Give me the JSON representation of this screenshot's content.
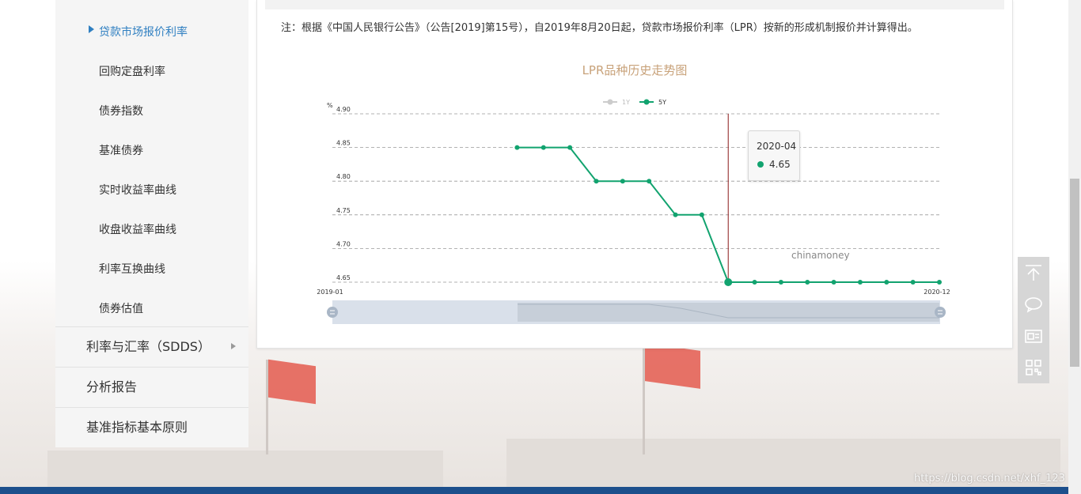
{
  "sidebar": {
    "sub_items": [
      {
        "label": "贷款市场报价利率",
        "active": true
      },
      {
        "label": "回购定盘利率"
      },
      {
        "label": "债券指数"
      },
      {
        "label": "基准债券"
      },
      {
        "label": "实时收益率曲线"
      },
      {
        "label": "收盘收益率曲线"
      },
      {
        "label": "利率互换曲线"
      },
      {
        "label": "债券估值"
      }
    ],
    "main_items": [
      {
        "label": "利率与汇率（SDDS）"
      },
      {
        "label": "分析报告"
      },
      {
        "label": "基准指标基本原则"
      }
    ]
  },
  "panel": {
    "note": "注：根据《中国人民银行公告》（公告[2019]第15号），自2019年8月20日起，贷款市场报价利率（LPR）按新的形成机制报价并计算得出。"
  },
  "chart_data": {
    "type": "line",
    "title": "LPR品种历史走势图",
    "ylabel": "%",
    "ylim": [
      4.65,
      4.9
    ],
    "y_ticks": [
      "4.65",
      "4.70",
      "4.75",
      "4.80",
      "4.85",
      "4.90"
    ],
    "x_labels": [
      "2019-01",
      "2020-12"
    ],
    "x": [
      "2019-08",
      "2019-09",
      "2019-10",
      "2019-11",
      "2019-12",
      "2020-01",
      "2020-02",
      "2020-03",
      "2020-04",
      "2020-05",
      "2020-06",
      "2020-07",
      "2020-08",
      "2020-09",
      "2020-10",
      "2020-11",
      "2020-12"
    ],
    "series": [
      {
        "name": "1Y",
        "color": "#cccccc",
        "visible": false,
        "values": []
      },
      {
        "name": "5Y",
        "color": "#12a36f",
        "visible": true,
        "values": [
          4.85,
          4.85,
          4.85,
          4.8,
          4.8,
          4.8,
          4.75,
          4.75,
          4.65,
          4.65,
          4.65,
          4.65,
          4.65,
          4.65,
          4.65,
          4.65,
          4.65
        ]
      }
    ],
    "legend_position": "top-center",
    "grid": true,
    "tooltip": {
      "date": "2020-04",
      "value": "4.65"
    },
    "watermark": "chinamoney"
  },
  "float_bar": {
    "icons": [
      "back-to-top-icon",
      "chat-icon",
      "feedback-icon",
      "qrcode-icon"
    ]
  },
  "url_watermark": "https://blog.csdn.net/xhf_123"
}
